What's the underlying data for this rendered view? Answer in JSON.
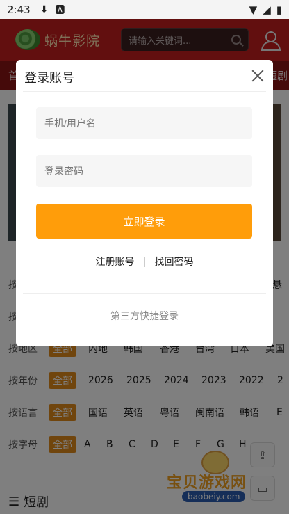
{
  "status_bar": {
    "time": "2:43",
    "icons": [
      "download-icon",
      "a-icon",
      "wifi-icon",
      "signal-icon",
      "battery-icon"
    ]
  },
  "header": {
    "app_name": "蜗牛影院",
    "search_placeholder": "请输入关键词..."
  },
  "nav": {
    "left_partial": "首",
    "right_partial": "短剧"
  },
  "filters": {
    "rows": [
      {
        "label": "按",
        "all": "",
        "options": []
      },
      {
        "label": "按",
        "all": "",
        "options": []
      },
      {
        "label": "按地区",
        "all": "全部",
        "options": [
          "内地",
          "韩国",
          "香港",
          "台湾",
          "日本",
          "美国"
        ]
      },
      {
        "label": "按年份",
        "all": "全部",
        "options": [
          "2026",
          "2025",
          "2024",
          "2023",
          "2022",
          "2"
        ]
      },
      {
        "label": "按语言",
        "all": "全部",
        "options": [
          "国语",
          "英语",
          "粤语",
          "闽南语",
          "韩语",
          "E"
        ]
      },
      {
        "label": "按字母",
        "all": "全部",
        "options": [
          "A",
          "B",
          "C",
          "D",
          "E",
          "F",
          "G",
          "H"
        ]
      }
    ],
    "right_partial": "悬"
  },
  "section_title": "短剧",
  "watermark": {
    "text": "宝贝游戏网",
    "url": "baobeiy.com"
  },
  "modal": {
    "title": "登录账号",
    "username_placeholder": "手机/用户名",
    "password_placeholder": "登录密码",
    "login_button": "立即登录",
    "register_link": "注册账号",
    "recover_link": "找回密码",
    "third_party_label": "第三方快捷登录"
  },
  "colors": {
    "header": "#c41e1e",
    "accent": "#ff9d0a",
    "filter_tag": "#e08a1a"
  }
}
